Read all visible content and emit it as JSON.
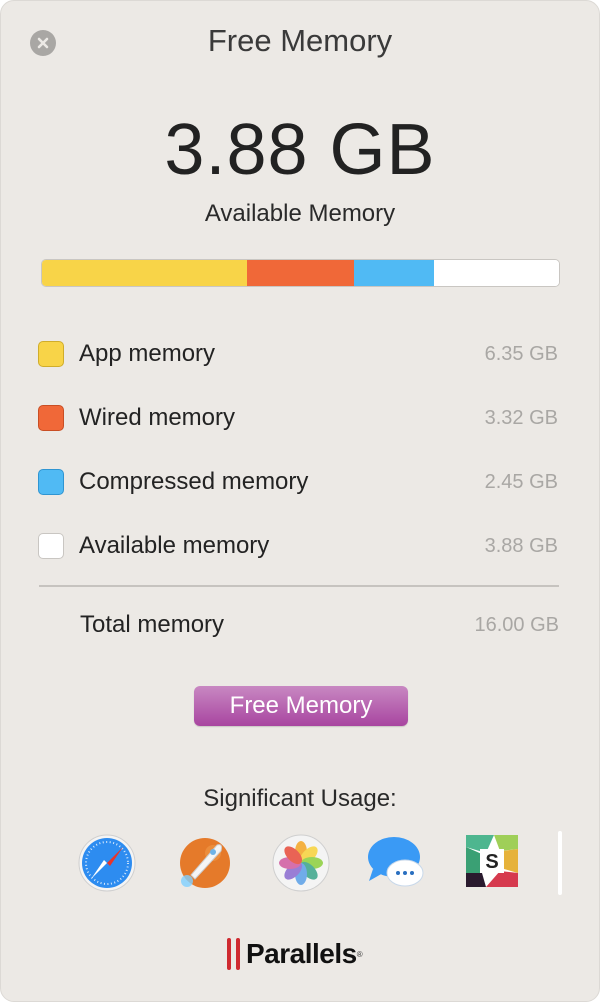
{
  "window": {
    "title": "Free Memory"
  },
  "summary": {
    "value": "3.88 GB",
    "label": "Available Memory"
  },
  "usage_bar": [
    {
      "name": "app",
      "gb": 6.35,
      "color": "#f8d448"
    },
    {
      "name": "wired",
      "gb": 3.32,
      "color": "#f06838"
    },
    {
      "name": "compressed",
      "gb": 2.45,
      "color": "#50baf4"
    },
    {
      "name": "available",
      "gb": 3.88,
      "color": "#ffffff"
    }
  ],
  "legend": [
    {
      "label": "App memory",
      "value": "6.35 GB",
      "color": "#f8d448",
      "border": "#d0ad2a"
    },
    {
      "label": "Wired memory",
      "value": "3.32 GB",
      "color": "#f06838",
      "border": "#c94e24"
    },
    {
      "label": "Compressed memory",
      "value": "2.45 GB",
      "color": "#50baf4",
      "border": "#2f95d2"
    },
    {
      "label": "Available memory",
      "value": "3.88 GB",
      "color": "#ffffff",
      "border": "#c9c6c2"
    }
  ],
  "total": {
    "label": "Total memory",
    "value": "16.00 GB"
  },
  "action": {
    "label": "Free Memory"
  },
  "significant": {
    "heading": "Significant Usage:",
    "apps": [
      "safari-icon",
      "rocket-app-icon",
      "photos-icon",
      "messages-icon",
      "slack-icon"
    ]
  },
  "brand": {
    "name": "Parallels",
    "mark": "®"
  }
}
